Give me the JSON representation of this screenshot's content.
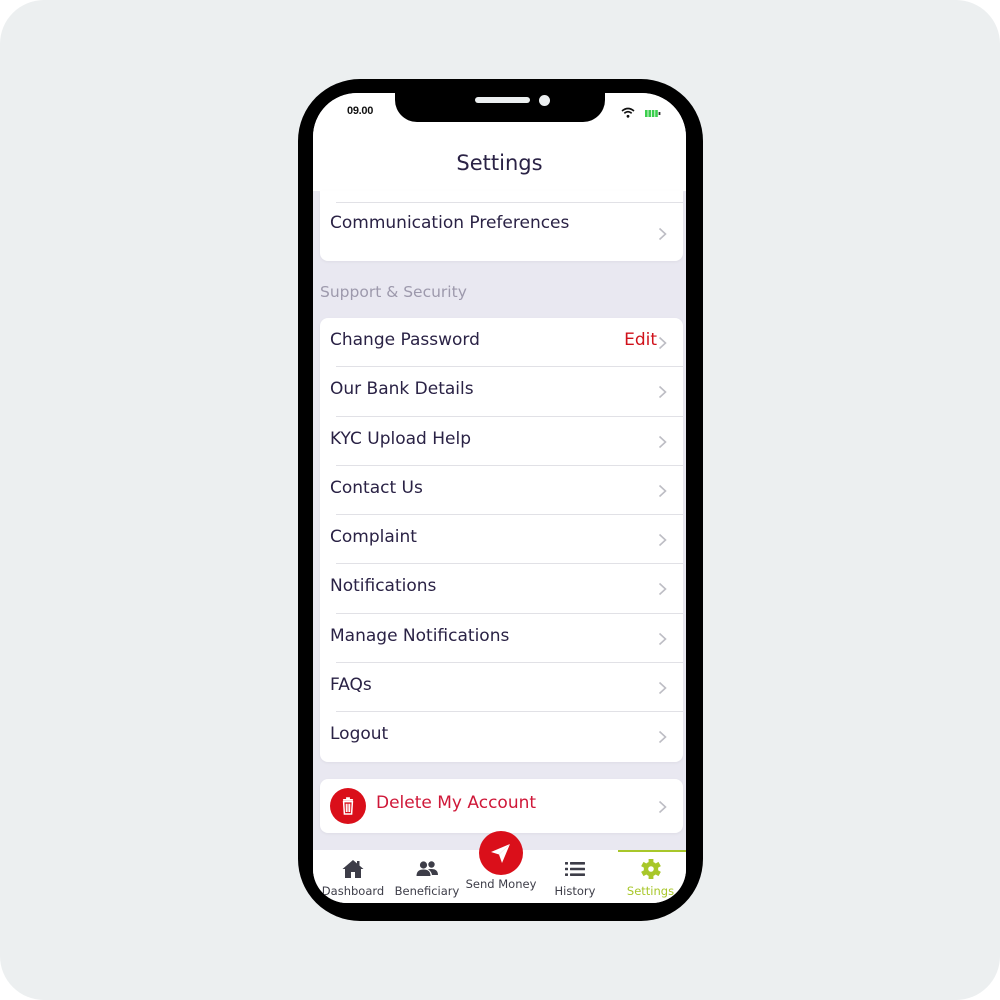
{
  "status_bar": {
    "time": "09.00",
    "wifi_icon": "wifi-icon",
    "battery_icon": "battery-icon",
    "battery_color": "#3ccf4e"
  },
  "header": {
    "title": "Settings"
  },
  "preferences_card": {
    "items": [
      {
        "label": "Communication Preferences",
        "icon": "chevron-right-icon"
      }
    ]
  },
  "support_section": {
    "heading": "Support & Security",
    "items": [
      {
        "label": "Change Password",
        "action": "Edit",
        "icon": "chevron-right-icon"
      },
      {
        "label": "Our Bank Details",
        "icon": "chevron-right-icon"
      },
      {
        "label": "KYC Upload Help",
        "icon": "chevron-right-icon"
      },
      {
        "label": "Contact Us",
        "icon": "chevron-right-icon"
      },
      {
        "label": "Complaint",
        "icon": "chevron-right-icon"
      },
      {
        "label": "Notifications",
        "icon": "chevron-right-icon"
      },
      {
        "label": "Manage Notifications",
        "icon": "chevron-right-icon"
      },
      {
        "label": "FAQs",
        "icon": "chevron-right-icon"
      },
      {
        "label": "Logout",
        "icon": "chevron-right-icon"
      }
    ]
  },
  "delete_account": {
    "label": "Delete My Account",
    "icon": "trash-icon"
  },
  "tab_bar": {
    "tabs": [
      {
        "label": "Dashboard",
        "icon": "home-icon",
        "active": false
      },
      {
        "label": "Beneficiary",
        "icon": "users-icon",
        "active": false
      },
      {
        "label": "Send Money",
        "icon": "paper-plane-icon",
        "active": false
      },
      {
        "label": "History",
        "icon": "list-icon",
        "active": false
      },
      {
        "label": "Settings",
        "icon": "gear-icon",
        "active": true
      }
    ]
  },
  "colors": {
    "brand_red": "#da0f1a",
    "active_tab": "#a8c72a",
    "text_primary": "#2a2245",
    "section_heading": "#9d99ac",
    "background": "#e9e8f1"
  }
}
